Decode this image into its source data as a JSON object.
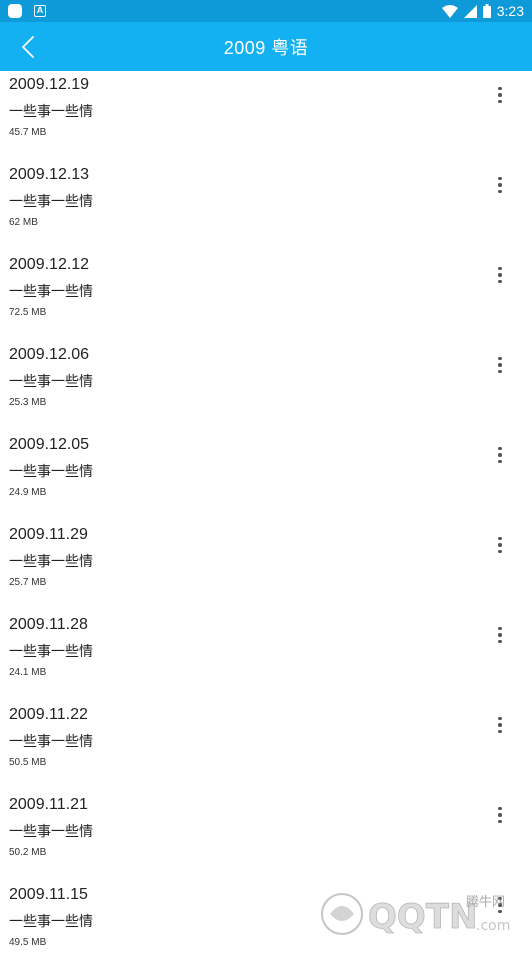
{
  "status_bar": {
    "time": "3:23",
    "icons": [
      "app-notification-icon",
      "a-icon",
      "wifi-icon",
      "signal-icon",
      "battery-icon"
    ]
  },
  "app_bar": {
    "title": "2009 粤语",
    "back_icon": "chevron-left-icon"
  },
  "items": [
    {
      "date": "2009.12.19",
      "title": "一些事一些情",
      "size": "45.7 MB"
    },
    {
      "date": "2009.12.13",
      "title": "一些事一些情",
      "size": "62 MB"
    },
    {
      "date": "2009.12.12",
      "title": "一些事一些情",
      "size": "72.5 MB"
    },
    {
      "date": "2009.12.06",
      "title": "一些事一些情",
      "size": "25.3 MB"
    },
    {
      "date": "2009.12.05",
      "title": "一些事一些情",
      "size": "24.9 MB"
    },
    {
      "date": "2009.11.29",
      "title": "一些事一些情",
      "size": "25.7 MB"
    },
    {
      "date": "2009.11.28",
      "title": "一些事一些情",
      "size": "24.1 MB"
    },
    {
      "date": "2009.11.22",
      "title": "一些事一些情",
      "size": "50.5 MB"
    },
    {
      "date": "2009.11.21",
      "title": "一些事一些情",
      "size": "50.2 MB"
    },
    {
      "date": "2009.11.15",
      "title": "一些事一些情",
      "size": "49.5 MB"
    }
  ],
  "watermark": {
    "brand_cn": "腾牛网",
    "brand_logo": "QQTN",
    "brand_suffix": ".com"
  },
  "colors": {
    "status_bar": "#0e9ad8",
    "app_bar": "#13b1f2",
    "text": "#222222"
  }
}
